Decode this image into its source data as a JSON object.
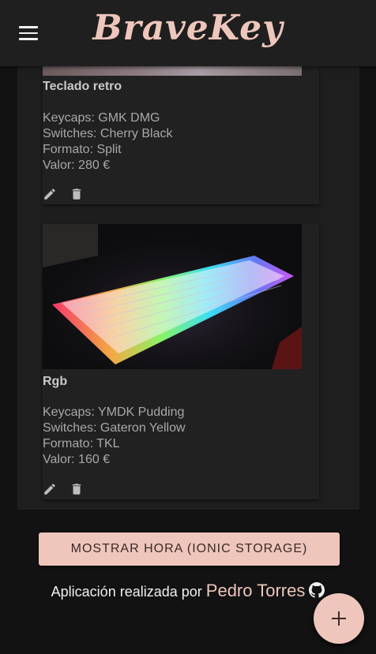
{
  "header": {
    "logo": "BraveKey",
    "menu_icon": "menu-icon"
  },
  "cards": [
    {
      "title": "Teclado retro",
      "lines": [
        "Keycaps: GMK DMG",
        "Switches: Cherry Black",
        "Formato: Split",
        "Valor: 280 €"
      ],
      "edit_icon": "pencil-icon",
      "delete_icon": "trash-icon"
    },
    {
      "title": "Rgb",
      "lines": [
        "Keycaps: YMDK Pudding",
        "Switches: Gateron Yellow",
        "Formato: TKL",
        "Valor: 160 €"
      ],
      "edit_icon": "pencil-icon",
      "delete_icon": "trash-icon"
    }
  ],
  "storage_button": "MOSTRAR HORA (IONIC STORAGE)",
  "footer": {
    "prefix": "Aplicación realizada por",
    "author": "Pedro Torres",
    "author_icon": "github-icon"
  },
  "fab": {
    "icon": "plus-icon"
  },
  "colors": {
    "accent": "#eec6bc",
    "background": "#121212",
    "card": "#212121"
  }
}
